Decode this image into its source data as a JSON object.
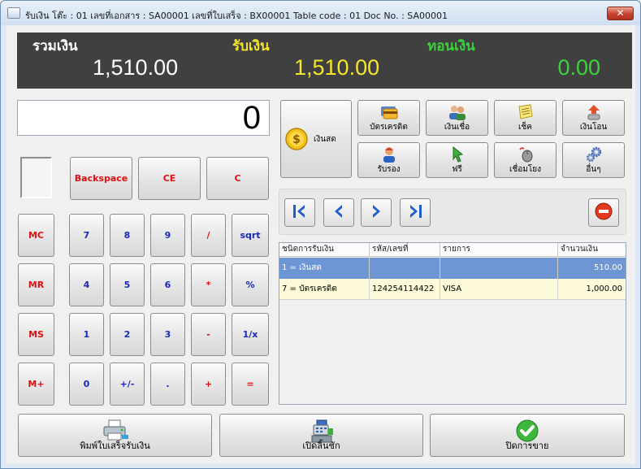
{
  "window": {
    "title": "รับเงิน โต๊ะ : 01  เลขที่เอกสาร : SA00001  เลขที่ใบเสร็จ : BX00001   Table code : 01   Doc No. : SA00001",
    "close_glyph": "✕"
  },
  "summary": {
    "total_label": "รวมเงิน",
    "total_value": "1,510.00",
    "received_label": "รับเงิน",
    "received_value": "1,510.00",
    "change_label": "ทอนเงิน",
    "change_value": "0.00"
  },
  "calculator": {
    "display": "0",
    "keys": {
      "backspace": "Backspace",
      "ce": "CE",
      "c": "C",
      "mc": "MC",
      "mr": "MR",
      "ms": "MS",
      "mplus": "M+",
      "k7": "7",
      "k8": "8",
      "k9": "9",
      "div": "/",
      "sqrt": "sqrt",
      "k4": "4",
      "k5": "5",
      "k6": "6",
      "mul": "*",
      "pct": "%",
      "k1": "1",
      "k2": "2",
      "k3": "3",
      "sub": "-",
      "inv": "1/x",
      "k0": "0",
      "neg": "+/-",
      "dot": ".",
      "add": "+",
      "eq": "="
    }
  },
  "payment_types": {
    "cash": "เงินสด",
    "credit_card": "บัตรเครดิต",
    "credit": "เงินเชื่อ",
    "cheque": "เช็ค",
    "transfer": "เงินโอน",
    "entertain": "รับรอง",
    "free": "ฟรี",
    "link": "เชื่อมโยง",
    "other": "อื่นๆ"
  },
  "table": {
    "columns": [
      "ชนิดการรับเงิน",
      "รหัส/เลขที่",
      "รายการ",
      "จำนวนเงิน"
    ],
    "rows": [
      {
        "type": "1 = เงินสด",
        "code": "",
        "item": "",
        "amount": "510.00"
      },
      {
        "type": "7 = บัตรเครดิต",
        "code": "124254114422",
        "item": "VISA",
        "amount": "1,000.00"
      }
    ]
  },
  "actions": {
    "print": "พิมพ์ใบเสร็จรับเงิน",
    "drawer": "เปิดลิ้นชัก",
    "close_sale": "ปิดการขาย"
  },
  "colors": {
    "total": "#ffffff",
    "received": "#f5e52e",
    "change": "#3bd23b",
    "selected_row": "#6e96d4",
    "alt_row": "#fcfad8"
  }
}
